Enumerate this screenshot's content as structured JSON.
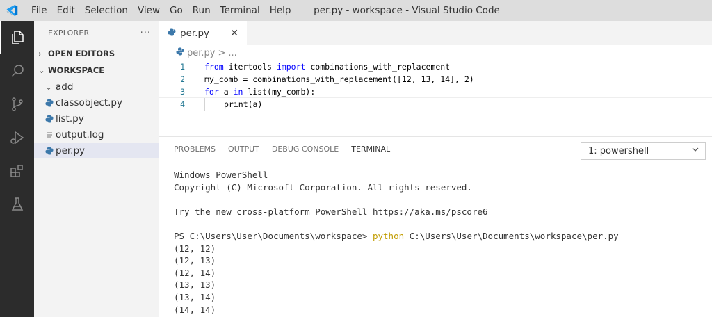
{
  "titlebar": {
    "menu": [
      "File",
      "Edit",
      "Selection",
      "View",
      "Go",
      "Run",
      "Terminal",
      "Help"
    ],
    "window_title": "per.py - workspace - Visual Studio Code",
    "accent": "#0078d4"
  },
  "activitybar": {
    "items": [
      "files-icon",
      "search-icon",
      "source-control-icon",
      "run-debug-icon",
      "extensions-icon",
      "testing-icon"
    ]
  },
  "sidebar": {
    "title": "EXPLORER",
    "more": "···",
    "open_editors": "OPEN EDITORS",
    "workspace": "WORKSPACE",
    "items": [
      {
        "label": "add",
        "type": "folder"
      },
      {
        "label": "classobject.py",
        "type": "python"
      },
      {
        "label": "list.py",
        "type": "python"
      },
      {
        "label": "output.log",
        "type": "log"
      },
      {
        "label": "per.py",
        "type": "python",
        "selected": true
      }
    ]
  },
  "editor": {
    "tab_label": "per.py",
    "close": "✕",
    "breadcrumb": {
      "file": "per.py",
      "sep": ">",
      "rest": "..."
    },
    "lines": [
      {
        "n": "1",
        "tokens": [
          {
            "t": "from",
            "k": "kw"
          },
          {
            "t": " itertools ",
            "k": "txt"
          },
          {
            "t": "import",
            "k": "kw"
          },
          {
            "t": " combinations_with_replacement",
            "k": "txt"
          }
        ]
      },
      {
        "n": "2",
        "tokens": [
          {
            "t": "my_comb = combinations_with_replacement([12, 13, 14], 2)",
            "k": "txt"
          }
        ]
      },
      {
        "n": "3",
        "tokens": [
          {
            "t": "for",
            "k": "kw"
          },
          {
            "t": " a ",
            "k": "txt"
          },
          {
            "t": "in",
            "k": "kw"
          },
          {
            "t": " list(my_comb):",
            "k": "txt"
          }
        ]
      },
      {
        "n": "4",
        "tokens": [
          {
            "t": "print(a)",
            "k": "txt"
          }
        ],
        "indent": true
      }
    ]
  },
  "panel": {
    "tabs": [
      "PROBLEMS",
      "OUTPUT",
      "DEBUG CONSOLE",
      "TERMINAL"
    ],
    "active_tab": "TERMINAL",
    "terminal_select": "1: powershell",
    "terminal_lines": [
      {
        "text": "Windows PowerShell"
      },
      {
        "text": "Copyright (C) Microsoft Corporation. All rights reserved."
      },
      {
        "text": ""
      },
      {
        "text": "Try the new cross-platform PowerShell https://aka.ms/pscore6"
      },
      {
        "text": ""
      },
      {
        "prompt": "PS C:\\Users\\User\\Documents\\workspace> ",
        "cmd": "python",
        "args": " C:\\Users\\User\\Documents\\workspace\\per.py"
      },
      {
        "text": "(12, 12)"
      },
      {
        "text": "(12, 13)"
      },
      {
        "text": "(12, 14)"
      },
      {
        "text": "(13, 13)"
      },
      {
        "text": "(13, 14)"
      },
      {
        "text": "(14, 14)"
      }
    ]
  }
}
